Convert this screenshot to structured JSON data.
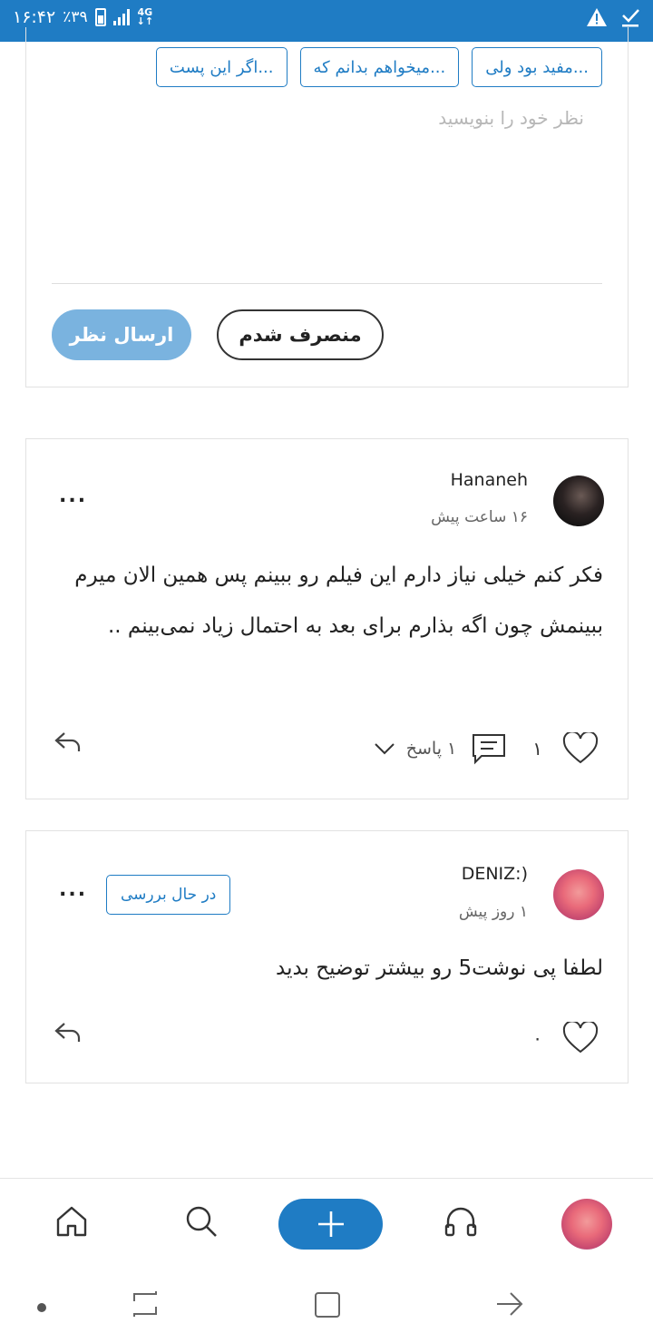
{
  "status_bar": {
    "time": "۱۶:۴۲",
    "battery": "٪۳۹",
    "network": "4G"
  },
  "composer": {
    "chips": [
      "مفید بود ولی...",
      "میخواهم بدانم که...",
      "اگر این پست..."
    ],
    "placeholder": "نظر خود را بنویسید",
    "send_label": "ارسال نظر",
    "cancel_label": "منصرف شدم"
  },
  "comments": [
    {
      "username": "Hananeh",
      "time": "۱۶ ساعت پیش",
      "text": "فکر کنم خیلی نیاز دارم این فیلم رو ببینم پس همین الان میرم ببینمش چون اگه بذارم برای بعد به احتمال زیاد نمی‌بینم ..",
      "likes": "۱",
      "replies": "۱ پاسخ",
      "more": "..."
    },
    {
      "username": "DENIZ:)",
      "time": "۱ روز پیش",
      "badge": "در حال بررسی",
      "text": "لطفا پی نوشت5 رو بیشتر توضیح بدید",
      "likes": "۰",
      "more": "..."
    }
  ],
  "bottom_nav": {
    "items": [
      "home-icon",
      "search-icon",
      "add-icon",
      "headphones-icon",
      "profile-avatar"
    ],
    "accent": "#1f7cc4"
  },
  "colors": {
    "primary": "#1f7cc4",
    "send_disabled": "#7ab3df"
  }
}
